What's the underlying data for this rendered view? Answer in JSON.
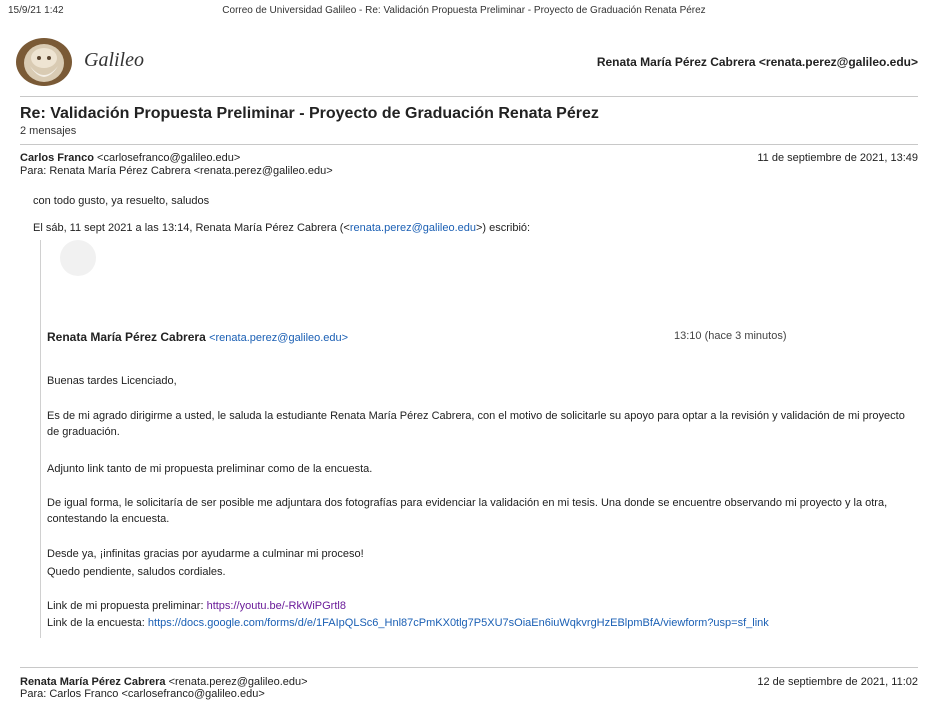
{
  "print_header": {
    "datetime": "15/9/21 1:42",
    "title": "Correo de Universidad Galileo - Re: Validación Propuesta Preliminar - Proyecto de Graduación Renata Pérez"
  },
  "logo": {
    "text": "Galileo"
  },
  "account": "Renata María Pérez Cabrera <renata.perez@galileo.edu>",
  "thread": {
    "subject": "Re: Validación Propuesta Preliminar - Proyecto de Graduación Renata Pérez",
    "count": "2 mensajes"
  },
  "message1": {
    "sender_name": "Carlos Franco",
    "sender_email": "<carlosefranco@galileo.edu>",
    "to": "Para: Renata María Pérez Cabrera <renata.perez@galileo.edu>",
    "date": "11 de septiembre de 2021, 13:49",
    "body": "con todo gusto, ya resuelto, saludos",
    "quote_header_pre": "El sáb, 11 sept 2021 a las 13:14, Renata María Pérez Cabrera (<",
    "quote_header_email": "renata.perez@galileo.edu",
    "quote_header_post": ">) escribió:"
  },
  "quoted": {
    "sender_name": "Renata María Pérez Cabrera",
    "sender_email": "<renata.perez@galileo.edu>",
    "time": "13:10 (hace 3 minutos)",
    "greeting": "Buenas tardes Licenciado,",
    "para1": "Es de mi agrado dirigirme a usted, le saluda la estudiante Renata María Pérez Cabrera, con el motivo de solicitarle su apoyo para optar a la revisión y validación de mi proyecto de graduación.",
    "para2": "Adjunto link tanto de mi propuesta preliminar como de la encuesta.",
    "para3": "De igual forma, le solicitaría de ser posible me adjuntara dos fotografías para evidenciar la validación en mi tesis. Una donde se encuentre observando mi proyecto y la otra, contestando la encuesta.",
    "para4_line1": "Desde ya, ¡infinitas gracias por ayudarme a culminar mi proceso!",
    "para4_line2": "Quedo pendiente, saludos cordiales.",
    "link1_label": "Link de mi propuesta preliminar: ",
    "link1_url": "https://youtu.be/-RkWiPGrtl8",
    "link2_label": "Link de la encuesta: ",
    "link2_url": "https://docs.google.com/forms/d/e/1FAIpQLSc6_Hnl87cPmKX0tlg7P5XU7sOiaEn6iuWqkvrgHzEBlpmBfA/viewform?usp=sf_link"
  },
  "message2": {
    "sender_name": "Renata María Pérez Cabrera",
    "sender_email": "<renata.perez@galileo.edu>",
    "to": "Para: Carlos Franco <carlosefranco@galileo.edu>",
    "date": "12 de septiembre de 2021, 11:02"
  },
  "colors": {
    "link": "#1a5fb4",
    "visited_link": "#6a1b9a",
    "divider": "#c8c8c8"
  }
}
